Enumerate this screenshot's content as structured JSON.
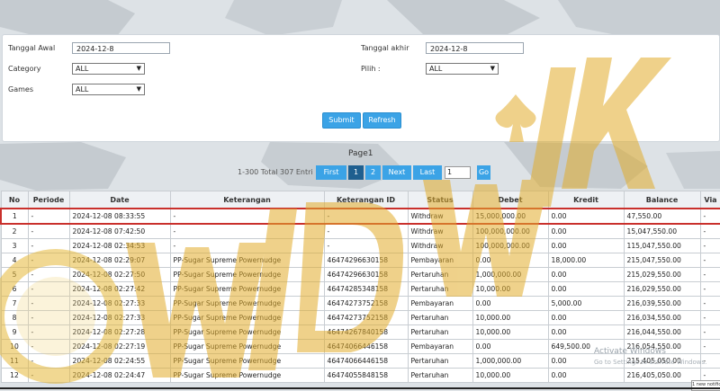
{
  "filters": {
    "tanggal_awal_label": "Tanggal Awal",
    "tanggal_awal_value": "2024-12-8",
    "tanggal_akhir_label": "Tanggal akhir",
    "tanggal_akhir_value": "2024-12-8",
    "category_label": "Category",
    "category_value": "ALL",
    "pilih_label": "Pilih  :",
    "pilih_value": "ALL",
    "games_label": "Games",
    "games_value": "ALL",
    "submit_label": "Submit",
    "refresh_label": "Refresh"
  },
  "pagination": {
    "page_label": "Page1",
    "total_label": "1-300 Total 307 Entri",
    "first_label": "First",
    "page1_label": "1",
    "page2_label": "2",
    "next_label": "Next",
    "last_label": "Last",
    "goto_value": "1",
    "go_label": "Go"
  },
  "table": {
    "columns": [
      "No",
      "Periode",
      "Date",
      "Keterangan",
      "Keterangan ID",
      "Status",
      "Debet",
      "Kredit",
      "Balance",
      "Via"
    ],
    "rows": [
      {
        "no": "1",
        "periode": "-",
        "date": "2024-12-08 08:33:55",
        "keterangan": "-",
        "ket_id": "-",
        "status": "Withdraw",
        "debet": "15,000,000.00",
        "kredit": "0.00",
        "balance": "47,550.00",
        "via": "-"
      },
      {
        "no": "2",
        "periode": "-",
        "date": "2024-12-08 07:42:50",
        "keterangan": "-",
        "ket_id": "-",
        "status": "Withdraw",
        "debet": "100,000,000.00",
        "kredit": "0.00",
        "balance": "15,047,550.00",
        "via": "-"
      },
      {
        "no": "3",
        "periode": "-",
        "date": "2024-12-08 02:34:53",
        "keterangan": "-",
        "ket_id": "-",
        "status": "Withdraw",
        "debet": "100,000,000.00",
        "kredit": "0.00",
        "balance": "115,047,550.00",
        "via": "-"
      },
      {
        "no": "4",
        "periode": "-",
        "date": "2024-12-08 02:29:07",
        "keterangan": "PP-Sugar Supreme Powernudge",
        "ket_id": "46474296630158",
        "status": "Pembayaran",
        "debet": "0.00",
        "kredit": "18,000.00",
        "balance": "215,047,550.00",
        "via": "-"
      },
      {
        "no": "5",
        "periode": "-",
        "date": "2024-12-08 02:27:50",
        "keterangan": "PP-Sugar Supreme Powernudge",
        "ket_id": "46474296630158",
        "status": "Pertaruhan",
        "debet": "1,000,000.00",
        "kredit": "0.00",
        "balance": "215,029,550.00",
        "via": "-"
      },
      {
        "no": "6",
        "periode": "-",
        "date": "2024-12-08 02:27:42",
        "keterangan": "PP-Sugar Supreme Powernudge",
        "ket_id": "46474285348158",
        "status": "Pertaruhan",
        "debet": "10,000.00",
        "kredit": "0.00",
        "balance": "216,029,550.00",
        "via": "-"
      },
      {
        "no": "7",
        "periode": "-",
        "date": "2024-12-08 02:27:33",
        "keterangan": "PP-Sugar Supreme Powernudge",
        "ket_id": "46474273752158",
        "status": "Pembayaran",
        "debet": "0.00",
        "kredit": "5,000.00",
        "balance": "216,039,550.00",
        "via": "-"
      },
      {
        "no": "8",
        "periode": "-",
        "date": "2024-12-08 02:27:33",
        "keterangan": "PP-Sugar Supreme Powernudge",
        "ket_id": "46474273752158",
        "status": "Pertaruhan",
        "debet": "10,000.00",
        "kredit": "0.00",
        "balance": "216,034,550.00",
        "via": "-"
      },
      {
        "no": "9",
        "periode": "-",
        "date": "2024-12-08 02:27:28",
        "keterangan": "PP-Sugar Supreme Powernudge",
        "ket_id": "46474267840158",
        "status": "Pertaruhan",
        "debet": "10,000.00",
        "kredit": "0.00",
        "balance": "216,044,550.00",
        "via": "-"
      },
      {
        "no": "10",
        "periode": "-",
        "date": "2024-12-08 02:27:19",
        "keterangan": "PP-Sugar Supreme Powernudge",
        "ket_id": "46474066446158",
        "status": "Pembayaran",
        "debet": "0.00",
        "kredit": "649,500.00",
        "balance": "216,054,550.00",
        "via": "-"
      },
      {
        "no": "11",
        "periode": "-",
        "date": "2024-12-08 02:24:55",
        "keterangan": "PP-Sugar Supreme Powernudge",
        "ket_id": "46474066446158",
        "status": "Pertaruhan",
        "debet": "1,000,000.00",
        "kredit": "0.00",
        "balance": "215,405,050.00",
        "via": "-"
      },
      {
        "no": "12",
        "periode": "-",
        "date": "2024-12-08 02:24:47",
        "keterangan": "PP-Sugar Supreme Powernudge",
        "ket_id": "46474055848158",
        "status": "Pertaruhan",
        "debet": "10,000.00",
        "kredit": "0.00",
        "balance": "216,405,050.00",
        "via": "-"
      }
    ]
  },
  "colors": {
    "accent": "#3ba3e6",
    "active_page": "#1f5f8f",
    "debit_red": "#c9302c",
    "link_blue": "#3a7fb8",
    "highlight_border": "#c9302c"
  },
  "watermark": {
    "logo_text": "WDWLJK"
  },
  "os_overlay": {
    "activate_title": "Activate Windows",
    "activate_sub": "Go to Settings to activate Windows.",
    "notif": "1 new notification"
  }
}
